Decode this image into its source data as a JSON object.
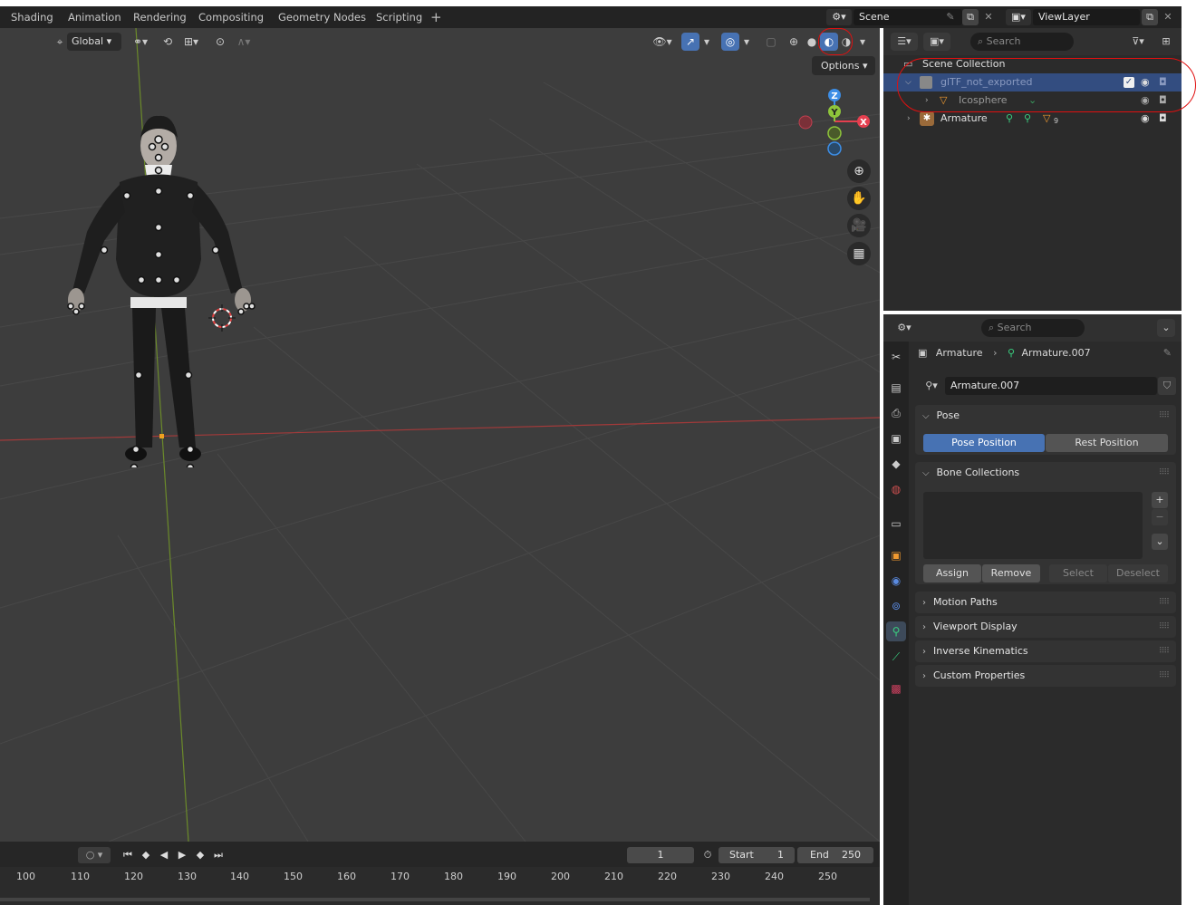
{
  "topbar": {
    "workspace_tabs": [
      "Shading",
      "Animation",
      "Rendering",
      "Compositing",
      "Geometry Nodes",
      "Scripting"
    ],
    "add_tab": "+",
    "scene": "Scene",
    "view_layer": "ViewLayer"
  },
  "viewport": {
    "transform_orientation": "Global",
    "options_label": "Options",
    "gizmo": {
      "z": "Z",
      "y": "Y",
      "x": "X"
    },
    "shading_mode_active": "solid"
  },
  "timeline": {
    "current_frame": "1",
    "start_label": "Start",
    "start_value": "1",
    "end_label": "End",
    "end_value": "250",
    "ruler": [
      "100",
      "110",
      "120",
      "130",
      "140",
      "150",
      "160",
      "170",
      "180",
      "190",
      "200",
      "210",
      "220",
      "230",
      "240",
      "250"
    ]
  },
  "outliner": {
    "search_placeholder": "Search",
    "rows": [
      {
        "label": "Scene Collection"
      },
      {
        "label": "glTF_not_exported"
      },
      {
        "label": "Icosphere"
      },
      {
        "label": "Armature"
      }
    ],
    "armature_bone_count": "9"
  },
  "properties": {
    "search_placeholder": "Search",
    "breadcrumb_object": "Armature",
    "breadcrumb_data": "Armature.007",
    "data_name": "Armature.007",
    "pose_panel": {
      "title": "Pose",
      "pose_position": "Pose Position",
      "rest_position": "Rest Position"
    },
    "bone_collections_panel": {
      "title": "Bone Collections",
      "assign": "Assign",
      "remove": "Remove",
      "select": "Select",
      "deselect": "Deselect"
    },
    "collapsed_panels": [
      "Motion Paths",
      "Viewport Display",
      "Inverse Kinematics",
      "Custom Properties"
    ]
  },
  "colors": {
    "accent_blue": "#4772b3",
    "selected_row": "#334d80",
    "annotation_red": "#e01010",
    "viewport_bg": "#3d3d3d",
    "axis_x": "#e53f4f",
    "axis_y": "#8ec43b",
    "axis_z": "#3d8ee6"
  }
}
